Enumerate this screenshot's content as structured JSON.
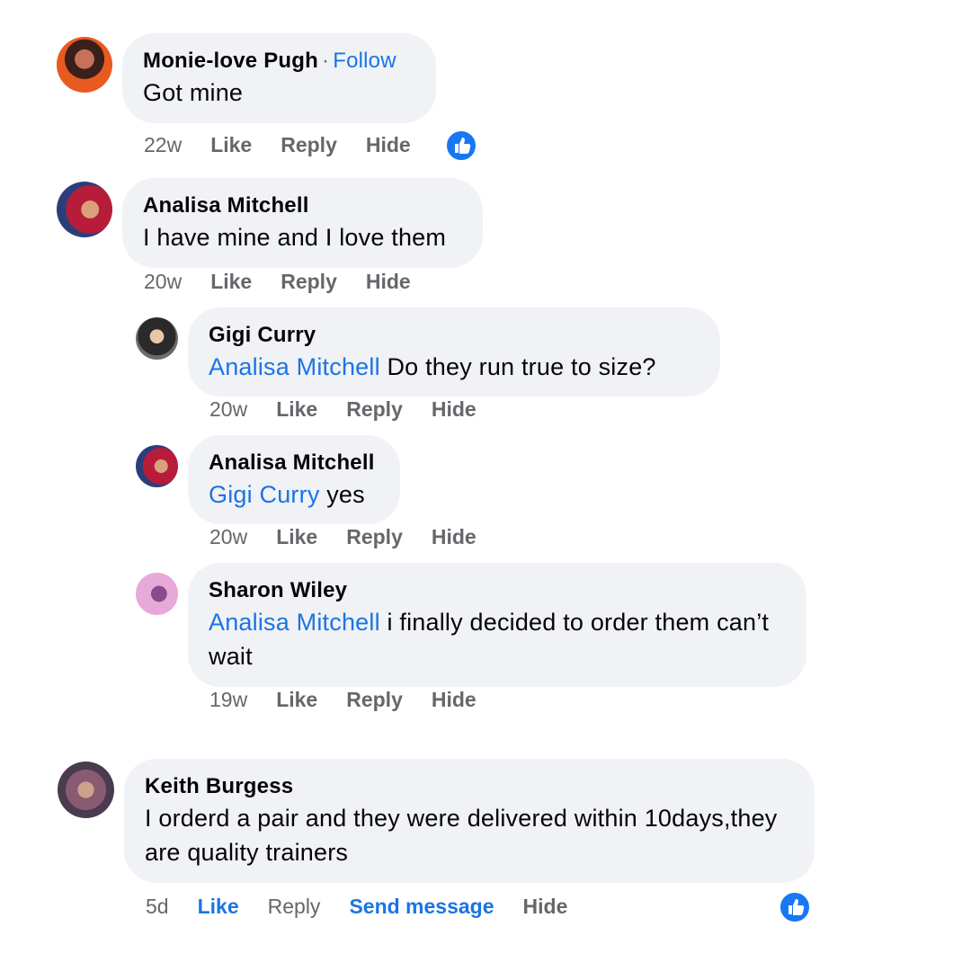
{
  "comments": [
    {
      "author": "Monie-love Pugh",
      "follow": "Follow",
      "text": "Got mine",
      "time": "22w",
      "like": "Like",
      "reply": "Reply",
      "hide": "Hide",
      "has_reaction": true
    },
    {
      "author": "Analisa Mitchell",
      "text": "I have mine and I love them",
      "time": "20w",
      "like": "Like",
      "reply": "Reply",
      "hide": "Hide"
    },
    {
      "author": "Gigi Curry",
      "mention": "Analisa Mitchell",
      "text": "Do they run true to size?",
      "time": "20w",
      "like": "Like",
      "reply": "Reply",
      "hide": "Hide"
    },
    {
      "author": "Analisa Mitchell",
      "mention": "Gigi Curry",
      "text": "yes",
      "time": "20w",
      "like": "Like",
      "reply": "Reply",
      "hide": "Hide"
    },
    {
      "author": "Sharon Wiley",
      "mention": "Analisa Mitchell",
      "text": "i finally decided to order them can’t wait",
      "time": "19w",
      "like": "Like",
      "reply": "Reply",
      "hide": "Hide"
    },
    {
      "author": "Keith Burgess",
      "text": "I orderd a pair and they were delivered within 10days,they are quality trainers",
      "time": "5d",
      "like": "Like",
      "reply": "Reply",
      "send_message": "Send message",
      "hide": "Hide",
      "has_reaction": true
    }
  ],
  "icons": {
    "reaction": "thumbs-up-icon"
  },
  "colors": {
    "bubble": "#f0f2f5",
    "link": "#1b74e4",
    "meta": "#65676b",
    "reaction": "#1877f2"
  }
}
